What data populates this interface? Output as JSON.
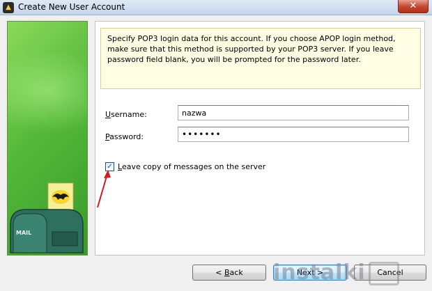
{
  "window": {
    "title": "Create New User Account",
    "close_label": "✕"
  },
  "info_text": "Specify POP3 login data for this account. If you choose APOP login method, make sure that this method is supported by your POP3 server. If you leave password field blank, you will be prompted for the password later.",
  "form": {
    "username_label_mnemonic": "U",
    "username_label_rest": "sername:",
    "username_value": "nazwa",
    "password_label_mnemonic": "P",
    "password_label_rest": "assword:",
    "password_value": "•••••••",
    "leave_copy_mnemonic": "L",
    "leave_copy_rest": "eave copy of messages on the server",
    "leave_copy_checked": true
  },
  "buttons": {
    "back_prefix": "< ",
    "back_mnemonic": "B",
    "back_rest": "ack",
    "next": "Next >",
    "cancel": "Cancel"
  },
  "watermark": "instalki",
  "illustration": {
    "mailbox_text": "MAIL"
  },
  "colors": {
    "panel_green": "#55b93a",
    "info_bg": "#fffde3",
    "arrow_red": "#d21c1c"
  }
}
